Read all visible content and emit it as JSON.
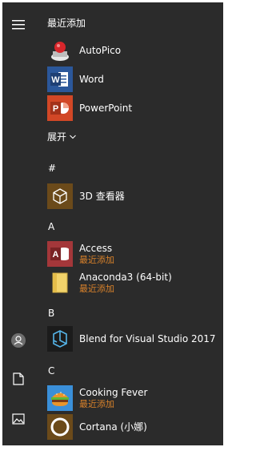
{
  "sections": {
    "recent_title": "最近添加",
    "expand_label": "展开",
    "letters": [
      "#",
      "A",
      "B",
      "C"
    ]
  },
  "apps": {
    "autopico": {
      "name": "AutoPico"
    },
    "word": {
      "name": "Word",
      "tile_letter": "W"
    },
    "powerpoint": {
      "name": "PowerPoint",
      "tile_letter": "P"
    },
    "viewer3d": {
      "name": "3D 查看器"
    },
    "access": {
      "name": "Access",
      "subtitle": "最近添加",
      "tile_letter": "A"
    },
    "anaconda": {
      "name": "Anaconda3 (64-bit)",
      "subtitle": "最近添加"
    },
    "blend": {
      "name": "Blend for Visual Studio 2017"
    },
    "cooking": {
      "name": "Cooking Fever",
      "subtitle": "最近添加"
    },
    "cortana": {
      "name": "Cortana (小娜)"
    }
  },
  "colors": {
    "background": "#2b2b2b",
    "subtitle": "#d9822b",
    "word": "#2b579a",
    "powerpoint": "#d24726",
    "access": "#a4373a",
    "viewer3d": "#6b4a1a",
    "blend": "#1b1b1b"
  },
  "icons": {
    "rail": [
      "hamburger-menu-icon",
      "user-avatar-icon",
      "document-icon",
      "pictures-icon"
    ]
  }
}
